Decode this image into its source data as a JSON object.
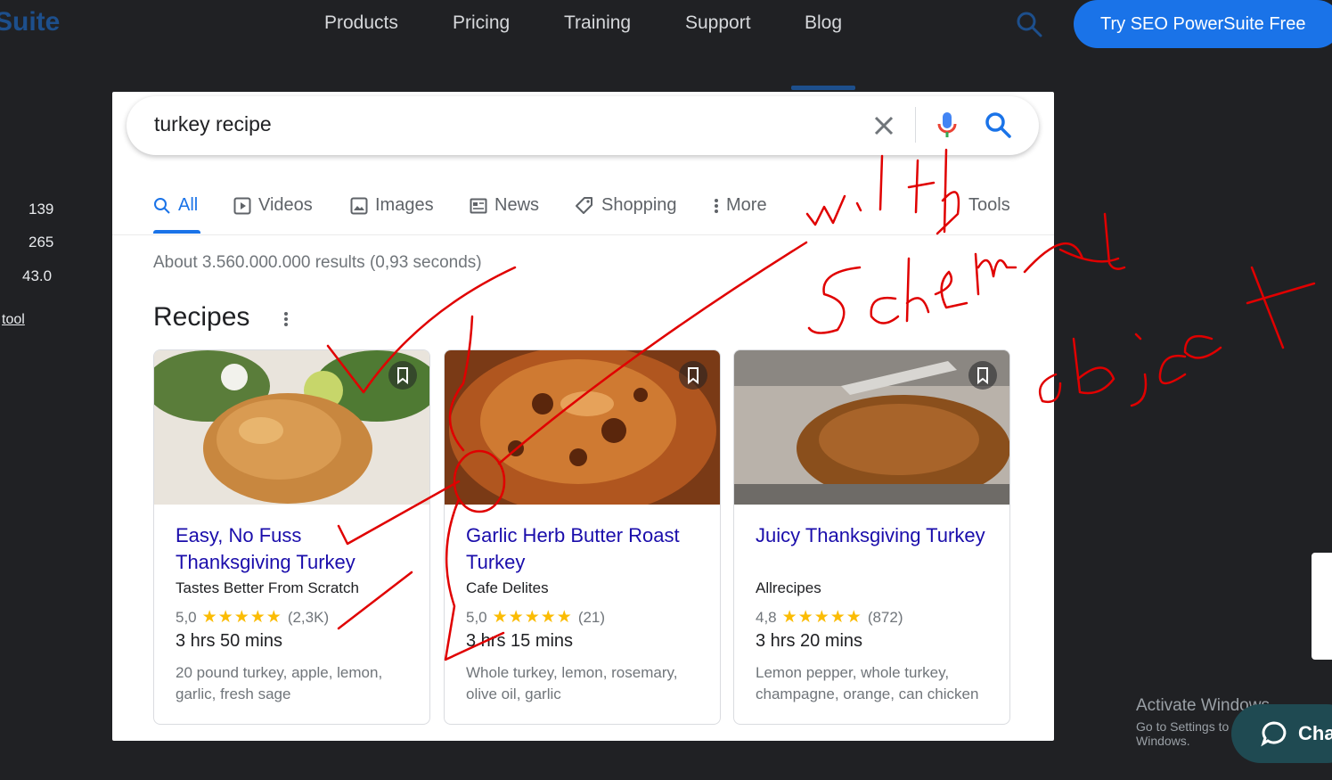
{
  "site": {
    "logo_text": "Suite",
    "nav_items": [
      "Products",
      "Pricing",
      "Training",
      "Support",
      "Blog"
    ],
    "cta_label": "Try SEO PowerSuite Free",
    "brand_color": "#1a73e8"
  },
  "left_stats": {
    "values": [
      "139",
      "265",
      "43.0"
    ],
    "link_text": "tool"
  },
  "serp": {
    "query": "turkey recipe",
    "tabs": [
      {
        "label": "All",
        "icon": "search-icon",
        "active": true
      },
      {
        "label": "Videos",
        "icon": "play-icon"
      },
      {
        "label": "Images",
        "icon": "image-icon"
      },
      {
        "label": "News",
        "icon": "news-icon"
      },
      {
        "label": "Shopping",
        "icon": "tag-icon"
      },
      {
        "label": "More",
        "icon": "more-vertical-icon"
      }
    ],
    "tools_label": "Tools",
    "results_count": "About 3.560.000.000 results (0,93 seconds)",
    "section_title": "Recipes",
    "recipes": [
      {
        "title": "Easy, No Fuss Thanksgiving Turkey",
        "source": "Tastes Better From Scratch",
        "rating": "5,0",
        "stars": "★★★★★",
        "reviews": "(2,3K)",
        "time": "3 hrs 50 mins",
        "ingredients": "20 pound turkey, apple, lemon, garlic, fresh sage"
      },
      {
        "title": "Garlic Herb Butter Roast Turkey",
        "source": "Cafe Delites",
        "rating": "5,0",
        "stars": "★★★★★",
        "reviews": "(21)",
        "time": "3 hrs 15 mins",
        "ingredients": "Whole turkey, lemon, rosemary, olive oil, garlic"
      },
      {
        "title": "Juicy Thanksgiving Turkey",
        "source": "Allrecipes",
        "rating": "4,8",
        "stars": "★★★★★",
        "reviews": "(872)",
        "time": "3 hrs 20 mins",
        "ingredients": "Lemon pepper, whole turkey, champagne, orange, can chicken"
      }
    ]
  },
  "annotation": {
    "handwritten_text": [
      "with",
      "schema",
      "object"
    ],
    "color": "#e00000"
  },
  "windows": {
    "activate_title": "Activate Windows",
    "activate_sub": "Go to Settings to activate Windows."
  },
  "chat": {
    "label": "Cha"
  }
}
